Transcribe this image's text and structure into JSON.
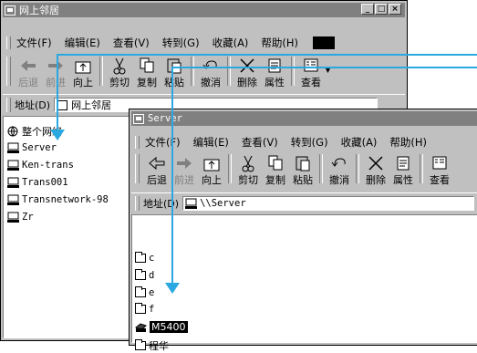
{
  "back_window": {
    "title": "网上邻居",
    "menu": [
      "文件(F)",
      "编辑(E)",
      "查看(V)",
      "转到(G)",
      "收藏(A)",
      "帮助(H)"
    ],
    "toolbar": [
      "后退",
      "前进",
      "向上",
      "剪切",
      "复制",
      "粘贴",
      "撤消",
      "删除",
      "属性",
      "查看"
    ],
    "address_label": "地址(D)",
    "address_value": "网上邻居",
    "items": [
      "整个网络",
      "Server",
      "Ken-trans",
      "Trans001",
      "Transnetwork-98",
      "Zr"
    ]
  },
  "front_window": {
    "title": "Server",
    "menu": [
      "文件(F)",
      "编辑(E)",
      "查看(V)",
      "转到(G)",
      "收藏(A)",
      "帮助(H)"
    ],
    "toolbar": [
      "后退",
      "前进",
      "向上",
      "剪切",
      "复制",
      "粘贴",
      "撤消",
      "删除",
      "属性",
      "查看"
    ],
    "address_label": "地址(D)",
    "address_value": "\\\\Server",
    "items": [
      "c",
      "d",
      "e",
      "f",
      "M5400",
      "程华"
    ],
    "selected_item": "M5400"
  },
  "colors": {
    "titlebar": "#808080",
    "window": "#c0c0c0",
    "arrow": "#2aa8e0",
    "selection": "#000000"
  }
}
